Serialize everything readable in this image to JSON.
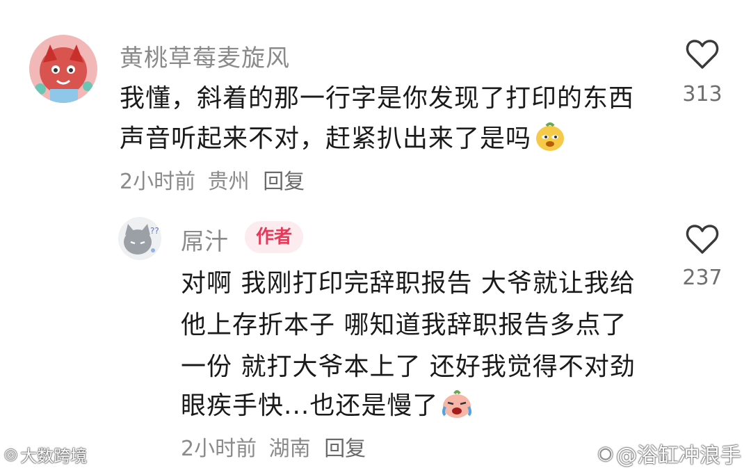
{
  "comment1": {
    "username": "黄桃草莓麦旋风",
    "text_line1": "我懂，斜着的那一行字是你发现了打印的东西",
    "text_line2": "声音听起来不对，赶紧扒出来了是吗",
    "emoji": "sly-face-emoji",
    "time": "2小时前",
    "location": "贵州",
    "reply_label": "回复",
    "likes": "313"
  },
  "comment2": {
    "username": "屌汁",
    "badge": "作者",
    "lines": [
      "对啊 我刚打印完辞职报告 大爷就让我给",
      "他上存折本子 哪知道我辞职报告多点了",
      "一份  就打大爷本上了 还好我觉得不对劲",
      "眼疾手快...也还是慢了"
    ],
    "emoji": "crying-laughing-emoji",
    "time": "2小时前",
    "location": "湖南",
    "reply_label": "回复",
    "likes": "237"
  },
  "watermarks": {
    "left": "大数跨境",
    "right": "@浴缸冲浪手"
  },
  "colors": {
    "text": "#1a1a1a",
    "meta": "#8a8a8a",
    "badge_bg": "#fdecef",
    "badge_text": "#e53a5a"
  }
}
